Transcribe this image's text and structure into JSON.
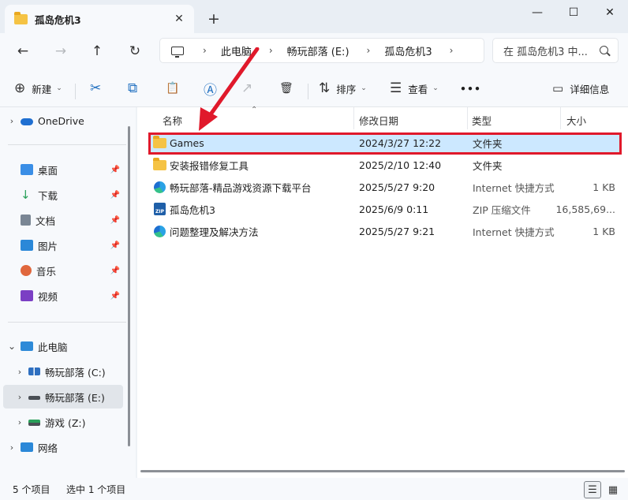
{
  "window": {
    "tab_title": "孤岛危机3",
    "tab_close": "✕",
    "new_tab": "+",
    "minimize": "—",
    "maximize": "☐",
    "close": "✕"
  },
  "nav": {
    "back": "←",
    "forward": "→",
    "up": "↑",
    "refresh": "↻",
    "breadcrumbs": [
      "此电脑",
      "畅玩部落 (E:)",
      "孤岛危机3"
    ],
    "separator": "›",
    "search_placeholder": "在 孤岛危机3 中..."
  },
  "toolbar": {
    "new_label": "新建",
    "sort_label": "排序",
    "view_label": "查看",
    "more_label": "•••",
    "details_label": "详细信息",
    "icons": {
      "new": "⊕",
      "cut": "✂",
      "copy": "⧉",
      "paste": "📋",
      "rename": "Ⓐ",
      "share": "↗",
      "delete": "🗑",
      "sort": "⇅",
      "view": "☰",
      "details": "▭"
    }
  },
  "sidebar": {
    "onedrive": "OneDrive",
    "quick": [
      {
        "label": "桌面",
        "color": "#3a8ee6"
      },
      {
        "label": "下载",
        "color": "#2aa05a"
      },
      {
        "label": "文档",
        "color": "#7a8694"
      },
      {
        "label": "图片",
        "color": "#2b88d8"
      },
      {
        "label": "音乐",
        "color": "#e0673d"
      },
      {
        "label": "视频",
        "color": "#7b3fc4"
      }
    ],
    "pin": "📌",
    "this_pc": "此电脑",
    "drives": [
      {
        "label": "畅玩部落 (C:)"
      },
      {
        "label": "畅玩部落 (E:)"
      },
      {
        "label": "游戏 (Z:)"
      }
    ],
    "network": "网络",
    "expand": "›",
    "expanded": "⌄"
  },
  "columns": {
    "name": "名称",
    "modified": "修改日期",
    "type": "类型",
    "size": "大小",
    "sort_indicator": "⌃"
  },
  "files": [
    {
      "name": "Games",
      "date": "2024/3/27 12:22",
      "type": "文件夹",
      "size": "",
      "icon": "folder"
    },
    {
      "name": "安装报错修复工具",
      "date": "2025/2/10 12:40",
      "type": "文件夹",
      "size": "",
      "icon": "folder"
    },
    {
      "name": "畅玩部落-精品游戏资源下载平台",
      "date": "2025/5/27 9:20",
      "type": "Internet 快捷方式",
      "size": "1 KB",
      "icon": "edge"
    },
    {
      "name": "孤岛危机3",
      "date": "2025/6/9 0:11",
      "type": "ZIP 压缩文件",
      "size": "16,585,69...",
      "icon": "zip"
    },
    {
      "name": "问题整理及解决方法",
      "date": "2025/5/27 9:21",
      "type": "Internet 快捷方式",
      "size": "1 KB",
      "icon": "edge"
    }
  ],
  "zip_label": "ZIP",
  "status": {
    "count": "5 个项目",
    "selected": "选中 1 个项目",
    "details_view": "☰",
    "tiles_view": "▦"
  },
  "colors": {
    "selection": "#cce8ff",
    "highlight": "#e0192b",
    "folder": "#f5c344"
  }
}
